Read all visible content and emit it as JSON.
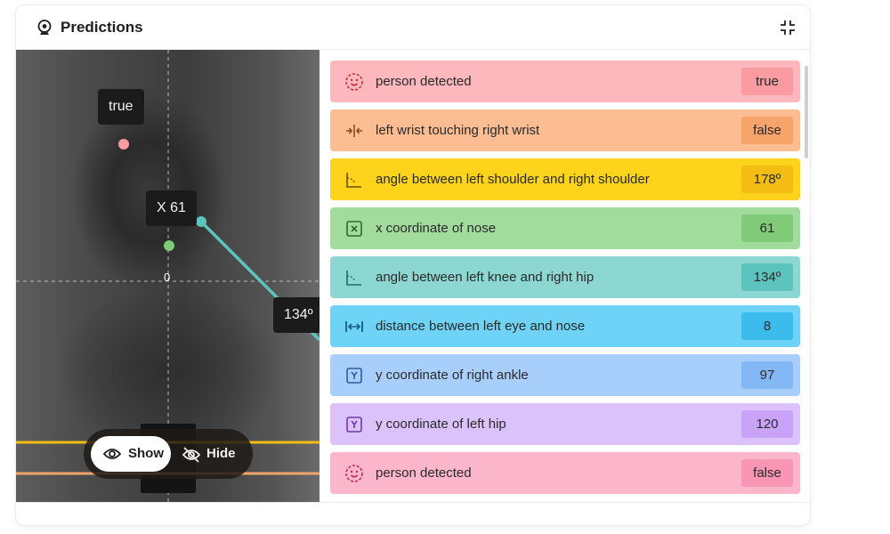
{
  "header": {
    "title": "Predictions",
    "icon": "webcam-icon",
    "collapse_icon": "collapse-icon"
  },
  "video": {
    "labels": {
      "value_tag": "true",
      "x_tag": "X 61",
      "origin": "0",
      "angle_tag": "134º"
    },
    "controls": {
      "show_label": "Show",
      "hide_label": "Hide"
    }
  },
  "predictions": [
    {
      "icon": "face-icon",
      "label": "person detected",
      "value": "true",
      "bg": "#fcb8bc",
      "chip": "#f99ba1",
      "accent": "#c8303a"
    },
    {
      "icon": "arrows-inward-icon",
      "label": "left wrist touching right wrist",
      "value": "false",
      "bg": "#fbbd91",
      "chip": "#f7a46a",
      "accent": "#8a4a1f"
    },
    {
      "icon": "angle-icon",
      "label": "angle between left shoulder and right shoulder",
      "value": "178º",
      "bg": "#fdd31c",
      "chip": "#f3bd15",
      "accent": "#6a5200"
    },
    {
      "icon": "x-box-icon",
      "label": "x coordinate of nose",
      "value": "61",
      "bg": "#a1dc9c",
      "chip": "#7fcb78",
      "accent": "#2d6a28"
    },
    {
      "icon": "angle-icon",
      "label": "angle between left knee and right hip",
      "value": "134º",
      "bg": "#8cd7d1",
      "chip": "#5cc4bc",
      "accent": "#1f6b66"
    },
    {
      "icon": "distance-icon",
      "label": "distance between left eye and nose",
      "value": "8",
      "bg": "#6ed3f7",
      "chip": "#3cbcec",
      "accent": "#125f80"
    },
    {
      "icon": "y-box-icon",
      "label": "y coordinate of right ankle",
      "value": "97",
      "bg": "#a8cffb",
      "chip": "#82b8f5",
      "accent": "#2a5da6"
    },
    {
      "icon": "y-box-icon",
      "label": "y coordinate of left hip",
      "value": "120",
      "bg": "#dcc2fb",
      "chip": "#c9a3f8",
      "accent": "#6a3aa8"
    },
    {
      "icon": "face-icon",
      "label": "person detected",
      "value": "false",
      "bg": "#fcb6cc",
      "chip": "#f995b5",
      "accent": "#c22a5a"
    }
  ]
}
